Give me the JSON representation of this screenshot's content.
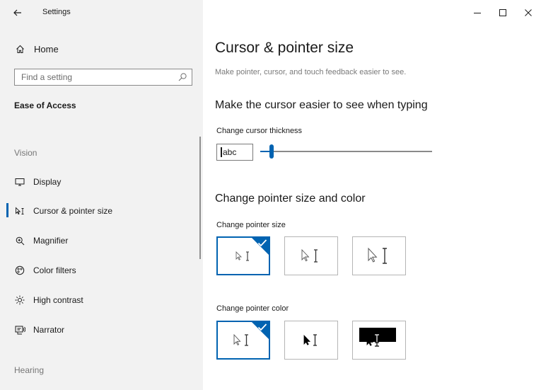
{
  "app": {
    "title": "Settings"
  },
  "sidebar": {
    "home_label": "Home",
    "search_placeholder": "Find a setting",
    "section_title": "Ease of Access",
    "groups": {
      "vision": "Vision",
      "hearing": "Hearing"
    },
    "items": [
      {
        "label": "Display",
        "icon": "monitor-icon"
      },
      {
        "label": "Cursor & pointer size",
        "icon": "cursor-pointer-icon",
        "active": true
      },
      {
        "label": "Magnifier",
        "icon": "magnifier-icon"
      },
      {
        "label": "Color filters",
        "icon": "color-filters-icon"
      },
      {
        "label": "High contrast",
        "icon": "high-contrast-icon"
      },
      {
        "label": "Narrator",
        "icon": "narrator-icon"
      }
    ]
  },
  "main": {
    "title": "Cursor & pointer size",
    "subtitle": "Make pointer, cursor, and touch feedback easier to see.",
    "cursor_section": {
      "heading": "Make the cursor easier to see when typing",
      "thickness_label": "Change cursor thickness",
      "preview_text": "abc",
      "thickness_value": 2,
      "thickness_min": 1,
      "thickness_max": 20
    },
    "pointer_section": {
      "heading": "Change pointer size and color",
      "size_label": "Change pointer size",
      "color_label": "Change pointer color",
      "size_options": [
        {
          "name": "small",
          "selected": true
        },
        {
          "name": "medium",
          "selected": false
        },
        {
          "name": "large",
          "selected": false
        }
      ],
      "color_options": [
        {
          "name": "white",
          "selected": true
        },
        {
          "name": "black",
          "selected": false
        },
        {
          "name": "inverted",
          "selected": false
        }
      ]
    }
  },
  "colors": {
    "accent": "#0063b1",
    "sidebar_bg": "#f2f2f2"
  }
}
